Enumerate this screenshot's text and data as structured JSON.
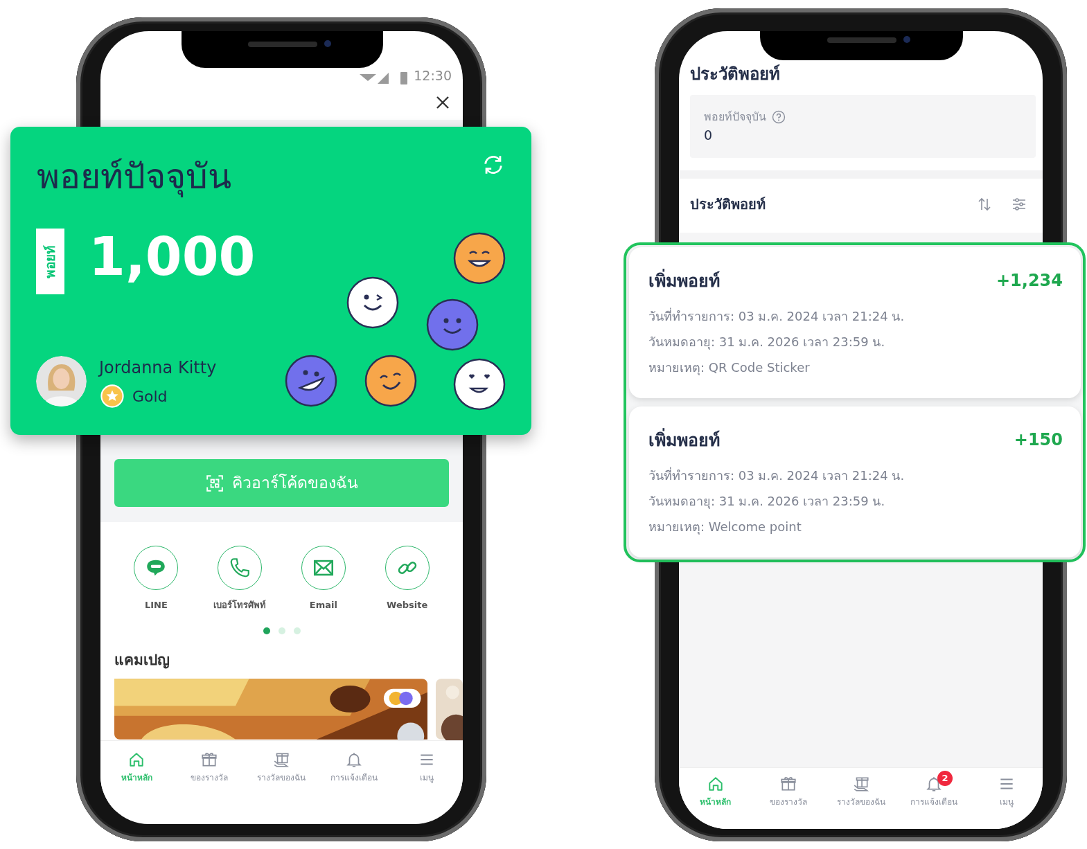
{
  "left_phone": {
    "status_time": "12:30",
    "points_card": {
      "title": "พอยท์ปัจจุบัน",
      "unit": "พอยท์",
      "points": "1,000",
      "member_name": "Jordanna Kitty",
      "tier": "Gold"
    },
    "qr_button": "คิวอาร์โค้ดของฉัน",
    "contacts": [
      {
        "kind": "line",
        "label": "LINE"
      },
      {
        "kind": "phone",
        "label": "เบอร์โทรศัพท์"
      },
      {
        "kind": "email",
        "label": "Email"
      },
      {
        "kind": "website",
        "label": "Website"
      }
    ],
    "pager": [
      {
        "selected": true
      },
      {
        "selected": false
      },
      {
        "selected": false
      }
    ],
    "campaign_title": "แคมเปญ",
    "bottom_nav": [
      {
        "kind": "home",
        "label": "หน้าหลัก",
        "selected": true
      },
      {
        "kind": "gift",
        "label": "ของรางวัล",
        "selected": false
      },
      {
        "kind": "reward",
        "label": "รางวัลของฉัน",
        "selected": false
      },
      {
        "kind": "bell",
        "label": "การแจ้งเตือน",
        "selected": false
      },
      {
        "kind": "menu",
        "label": "เมนู",
        "selected": false
      }
    ]
  },
  "right_phone": {
    "title": "ประวัติพอยท์",
    "balance_label": "พอยท์ปัจจุบัน",
    "balance_value": "0",
    "history_title": "ประวัติพอยท์",
    "history": [
      {
        "title": "เพิ่มพอยท์",
        "amount": "+1,234",
        "lines": [
          "วันที่ทำรายการ: 03 ม.ค. 2024 เวลา 21:24 น.",
          "วันหมดอายุ: 31 ม.ค. 2026 เวลา 23:59 น.",
          "หมายเหตุ: QR Code Sticker"
        ]
      },
      {
        "title": "เพิ่มพอยท์",
        "amount": "+150",
        "lines": [
          "วันที่ทำรายการ: 03 ม.ค. 2024 เวลา 21:24 น.",
          "วันหมดอายุ: 31 ม.ค. 2026 เวลา 23:59 น.",
          "หมายเหตุ: Welcome point"
        ]
      }
    ],
    "bottom_nav": [
      {
        "kind": "home",
        "label": "หน้าหลัก",
        "selected": true
      },
      {
        "kind": "gift",
        "label": "ของรางวัล",
        "selected": false
      },
      {
        "kind": "reward",
        "label": "รางวัลของฉัน",
        "selected": false
      },
      {
        "kind": "bell",
        "label": "การแจ้งเตือน",
        "selected": false,
        "badge": "2"
      },
      {
        "kind": "menu",
        "label": "เมนู",
        "selected": false
      }
    ]
  }
}
